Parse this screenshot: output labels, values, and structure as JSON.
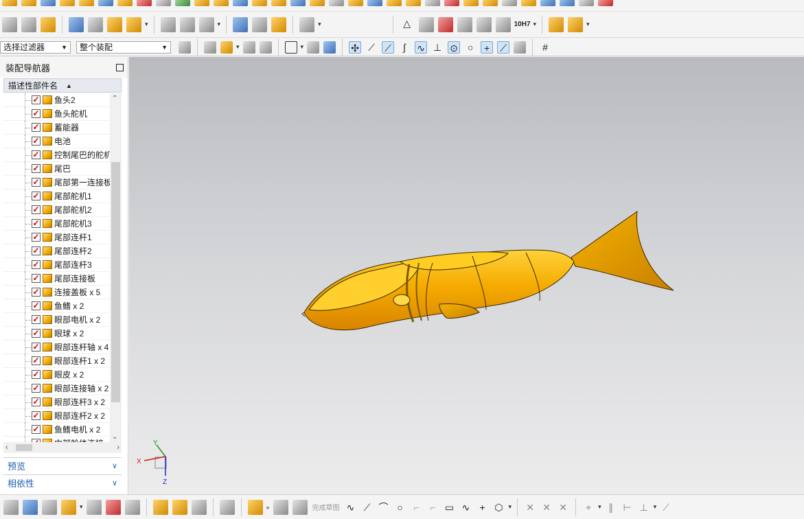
{
  "toolbar": {
    "filter_select": "选择过滤器",
    "assembly_select": "整个装配",
    "fit_label": "10H7"
  },
  "navigator": {
    "title": "装配导航器",
    "column_header": "描述性部件名",
    "items": [
      "鱼头2",
      "鱼头舵机",
      "蓄能器",
      "电池",
      "控制尾巴的舵机",
      "尾巴",
      "尾部第一连接板",
      "尾部舵机1",
      "尾部舵机2",
      "尾部舵机3",
      "尾部连杆1",
      "尾部连杆2",
      "尾部连杆3",
      "尾部连接板",
      "连接盖板 x 5",
      "鱼鳍 x 2",
      "眼部电机 x 2",
      "眼球 x 2",
      "眼部连杆轴 x 4",
      "眼部连杆1 x 2",
      "眼皮 x 2",
      "眼部连接轴 x 2",
      "眼部连杆3 x 2",
      "眼部连杆2 x 2",
      "鱼鳍电机 x 2",
      "中部舱体连接"
    ],
    "panels": {
      "preview": "预览",
      "dependencies": "相依性"
    }
  },
  "viewport": {
    "triad": {
      "x": "X",
      "y": "Y",
      "z": "Z"
    },
    "model_color": "#f2a900"
  },
  "bottom_toolbar": {
    "finish_sketch": "完成草图"
  },
  "colors": {
    "accent_blue": "#2060b0",
    "check_red": "#d00000"
  }
}
